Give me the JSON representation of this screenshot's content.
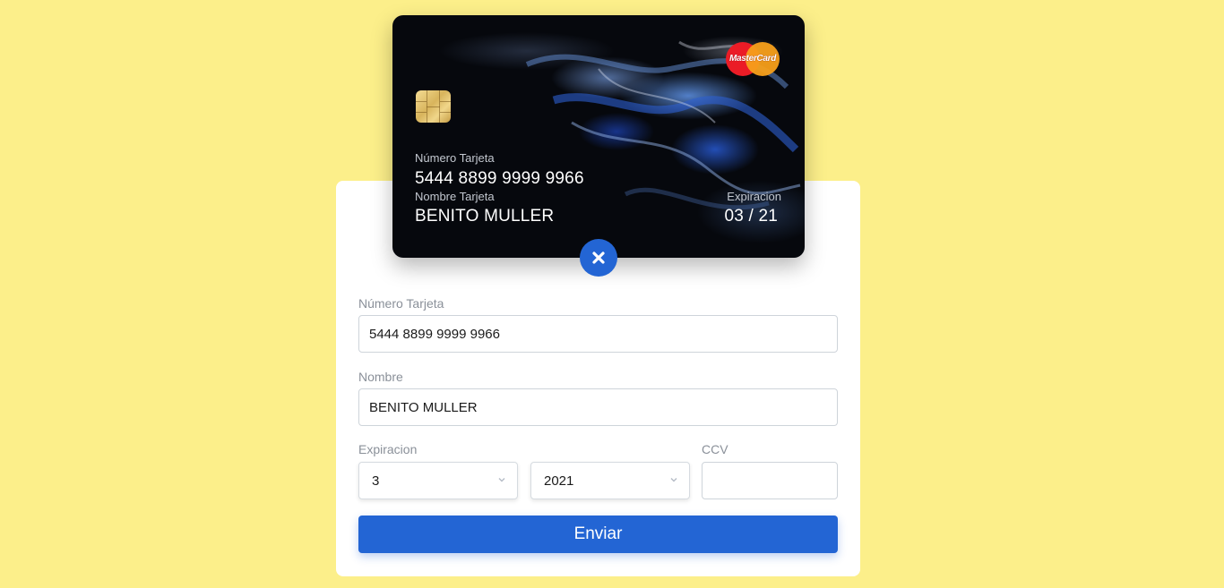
{
  "card": {
    "brand": "MasterCard",
    "number_label": "Número Tarjeta",
    "number_value": "5444 8899 9999 9966",
    "name_label": "Nombre Tarjeta",
    "name_value": "BENITO MULLER",
    "expiry_label": "Expiracion",
    "expiry_value": "03 / 21"
  },
  "form": {
    "number_label": "Número Tarjeta",
    "number_value": "5444 8899 9999 9966",
    "name_label": "Nombre",
    "name_value": "BENITO MULLER",
    "expiry_label": "Expiracion",
    "month_value": "3",
    "year_value": "2021",
    "ccv_label": "CCV",
    "ccv_value": "",
    "submit_label": "Enviar"
  },
  "icons": {
    "close": "close-icon",
    "chip": "chip-icon",
    "select_chevron": "chevron-down-icon"
  },
  "colors": {
    "background": "#fcef8a",
    "accent": "#2365d4",
    "card_bg": "#06080d"
  }
}
